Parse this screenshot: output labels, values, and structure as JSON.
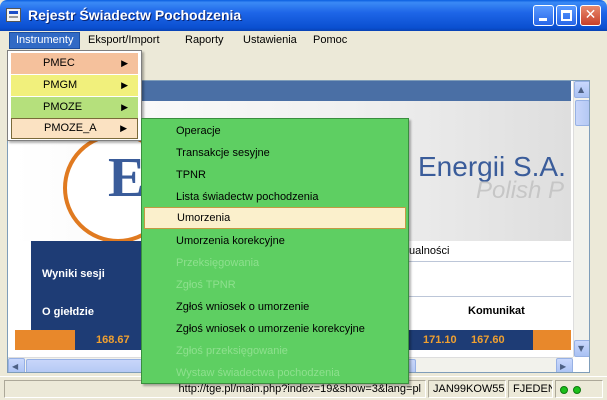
{
  "window": {
    "title": "Rejestr Świadectw Pochodzenia"
  },
  "menubar": [
    {
      "label": "Instrumenty",
      "active": true
    },
    {
      "label": "Eksport/Import"
    },
    {
      "label": "Raporty"
    },
    {
      "label": "Ustawienia"
    },
    {
      "label": "Pomoc"
    }
  ],
  "dropdown": [
    {
      "label": "PMEC",
      "color": "#f5c19c"
    },
    {
      "label": "PMGM",
      "color": "#f1f07c"
    },
    {
      "label": "PMOZE",
      "color": "#b5e07c"
    },
    {
      "label": "PMOZE_A",
      "color": "#fbe2c2",
      "selected": true
    }
  ],
  "submenu": [
    {
      "label": "Operacje"
    },
    {
      "label": "Transakcje sesyjne"
    },
    {
      "label": "TPNR"
    },
    {
      "label": "Lista świadectw pochodzenia"
    },
    {
      "label": "Umorzenia",
      "highlight": true
    },
    {
      "label": "Umorzenia korekcyjne"
    },
    {
      "label": "Przeksięgowania",
      "disabled": true
    },
    {
      "label": "Zgłoś TPNR",
      "disabled": true
    },
    {
      "label": "Zgłoś wniosek o umorzenie"
    },
    {
      "label": "Zgłoś wniosek o umorzenie korekcyjne"
    },
    {
      "label": "Zgłoś przeksięgowanie",
      "disabled": true
    },
    {
      "label": "Wystaw świadectwa pochodzenia",
      "disabled": true
    }
  ],
  "web": {
    "company_name": "Energii S.A.",
    "company_sub": "Polish P",
    "nav": [
      "Wyniki sesji",
      "O giełdzie"
    ],
    "aktualnosci": "tualności",
    "komunikat": "Komunikat",
    "ticker": [
      "168.67",
      "171.10",
      "167.60"
    ]
  },
  "statusbar": {
    "url": "http://tge.pl/main.php?index=19&show=3&lang=pl",
    "user": "JAN99KOW55",
    "unit": "FJEDEN"
  },
  "colors": {
    "accent": "#316ac5",
    "submenu_bg": "#5ecf62",
    "highlight_bg": "#fbf0cc"
  }
}
